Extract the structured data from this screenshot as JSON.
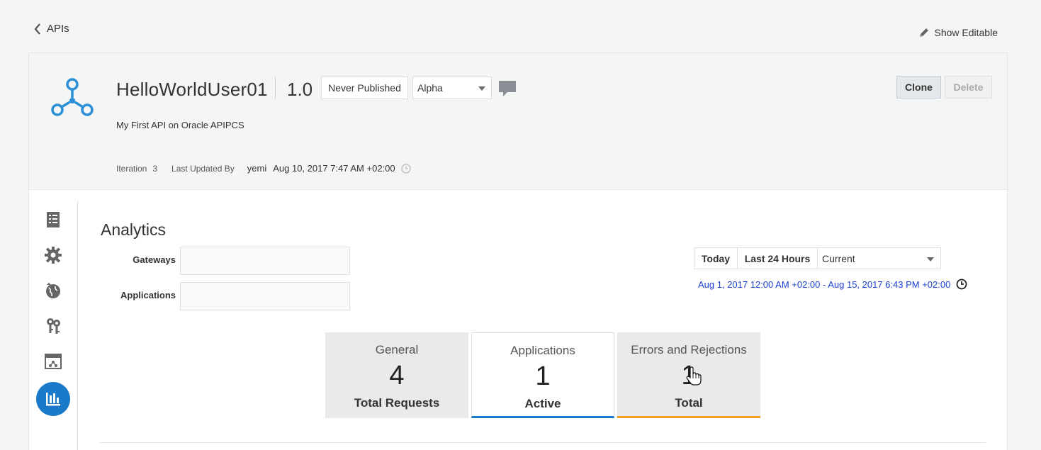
{
  "nav": {
    "back_label": "APIs",
    "show_editable_label": "Show Editable"
  },
  "header": {
    "icon": "api-network-icon",
    "title": "HelloWorldUser01",
    "version": "1.0",
    "publish_status": "Never Published",
    "stage": "Alpha",
    "description": "My First API on Oracle APIPCS",
    "iteration_label": "Iteration",
    "iteration_value": "3",
    "last_updated_label": "Last Updated By",
    "last_updated_user": "yemi",
    "last_updated_date": "Aug 10, 2017 7:47 AM +02:00",
    "clone_label": "Clone",
    "delete_label": "Delete"
  },
  "sidebar": {
    "items": [
      {
        "name": "overview",
        "icon": "document-icon"
      },
      {
        "name": "policies",
        "icon": "gear-icon"
      },
      {
        "name": "deployments",
        "icon": "globe-icon"
      },
      {
        "name": "grants",
        "icon": "keys-icon"
      },
      {
        "name": "publication",
        "icon": "portal-icon"
      },
      {
        "name": "analytics",
        "icon": "bar-chart-icon",
        "active": true
      }
    ]
  },
  "analytics": {
    "title": "Analytics",
    "gateways_label": "Gateways",
    "applications_label": "Applications",
    "range_today": "Today",
    "range_last24": "Last 24 Hours",
    "range_current": "Current",
    "date_range": "Aug 1, 2017 12:00 AM +02:00 - Aug 15, 2017 6:43 PM +02:00",
    "tiles": [
      {
        "title": "General",
        "value": "4",
        "label": "Total Requests"
      },
      {
        "title": "Applications",
        "value": "1",
        "label": "Active"
      },
      {
        "title": "Errors and Rejections",
        "value": "1",
        "label": "Total"
      }
    ]
  },
  "colors": {
    "accent": "#1a7ac9",
    "warning": "#f0a020",
    "link": "#1a3fd3"
  }
}
